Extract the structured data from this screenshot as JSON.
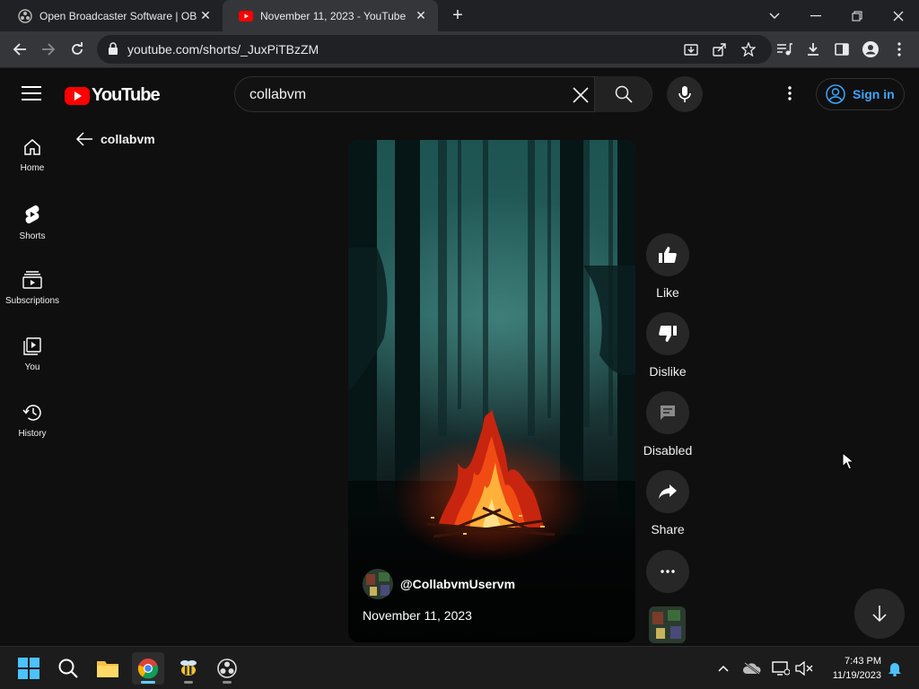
{
  "browser": {
    "tabs": [
      {
        "title": "Open Broadcaster Software | OBS"
      },
      {
        "title": "November 11, 2023 - YouTube"
      }
    ],
    "url": "youtube.com/shorts/_JuxPiTBzZM"
  },
  "youtube": {
    "logo_text": "YouTube",
    "search_value": "collabvm",
    "sign_in_label": "Sign in",
    "sidebar": [
      {
        "label": "Home"
      },
      {
        "label": "Shorts"
      },
      {
        "label": "Subscriptions"
      },
      {
        "label": "You"
      },
      {
        "label": "History"
      }
    ],
    "back_label": "collabvm",
    "video": {
      "channel": "@CollabvmUservm",
      "date": "November 11, 2023"
    },
    "actions": {
      "like": "Like",
      "dislike": "Dislike",
      "comments": "Disabled",
      "share": "Share"
    }
  },
  "taskbar": {
    "time": "7:43 PM",
    "date": "11/19/2023"
  },
  "colors": {
    "youtube_red": "#ff0000",
    "link_blue": "#3ea6ff",
    "background": "#0f0f0f"
  }
}
